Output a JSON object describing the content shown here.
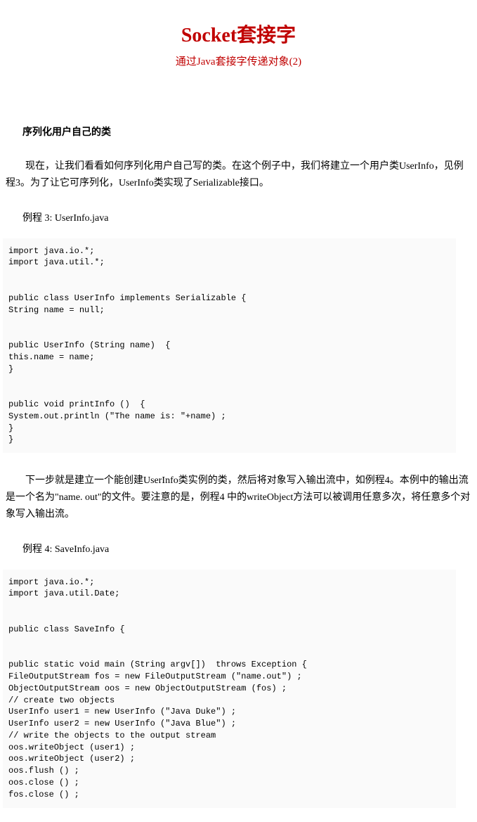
{
  "title": "Socket套接字",
  "subtitle": "通过Java套接字传递对象(2)",
  "section_heading": "序列化用户自己的类",
  "paragraph1": "现在，让我们看看如何序列化用户自己写的类。在这个例子中，我们将建立一个用户类UserInfo，见例程3。为了让它可序列化，UserInfo类实现了Serializable接口。",
  "code_label1": "例程 3: UserInfo.java",
  "code1": "import java.io.*;\nimport java.util.*;\n\n\npublic class UserInfo implements Serializable {\nString name = null;\n\n\npublic UserInfo (String name)  {\nthis.name = name;\n}\n\n\npublic void printInfo ()  {\nSystem.out.println (\"The name is: \"+name) ;\n}\n}",
  "paragraph2": "下一步就是建立一个能创建UserInfo类实例的类，然后将对象写入输出流中，如例程4。本例中的输出流是一个名为\"name. out\"的文件。要注意的是，例程4 中的writeObject方法可以被调用任意多次，将任意多个对象写入输出流。",
  "code_label2": "例程 4: SaveInfo.java",
  "code2": "import java.io.*;\nimport java.util.Date;\n\n\npublic class SaveInfo {\n\n\npublic static void main (String argv[])  throws Exception {\nFileOutputStream fos = new FileOutputStream (\"name.out\") ;\nObjectOutputStream oos = new ObjectOutputStream (fos) ;\n// create two objects\nUserInfo user1 = new UserInfo (\"Java Duke\") ;\nUserInfo user2 = new UserInfo (\"Java Blue\") ;\n// write the objects to the output stream\noos.writeObject (user1) ;\noos.writeObject (user2) ;\noos.flush () ;\noos.close () ;\nfos.close () ;"
}
